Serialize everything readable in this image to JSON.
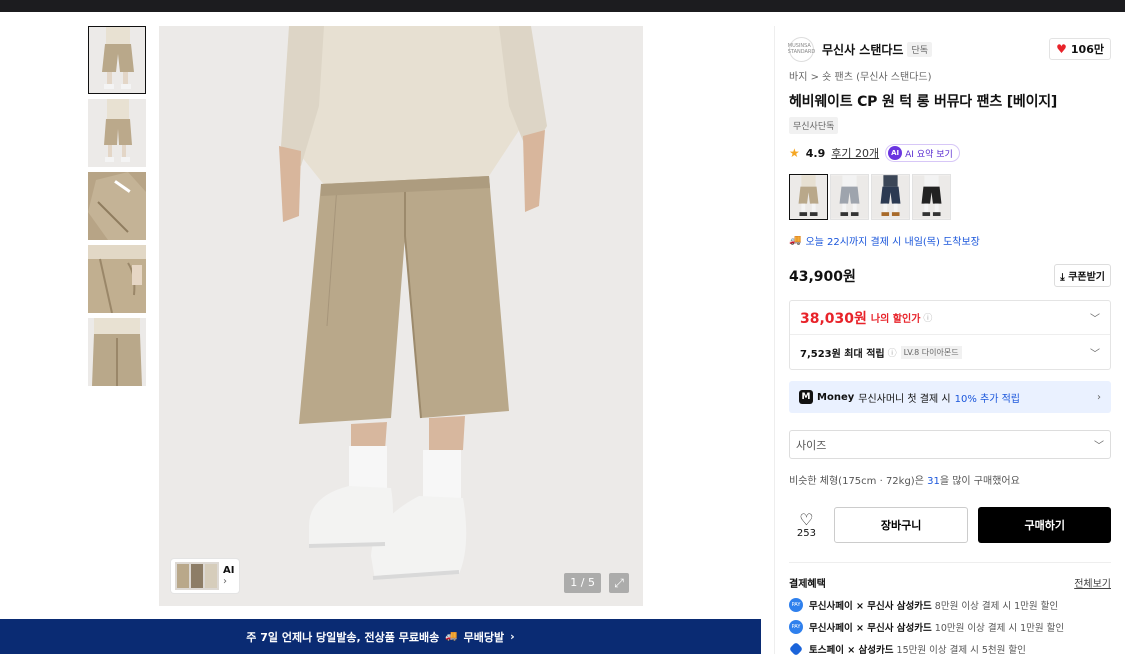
{
  "thumbnails": [
    {
      "alt": "thumbnail-1"
    },
    {
      "alt": "thumbnail-2"
    },
    {
      "alt": "thumbnail-3"
    },
    {
      "alt": "thumbnail-4"
    },
    {
      "alt": "thumbnail-5"
    }
  ],
  "gallery": {
    "ai_label": "AI",
    "ai_arrow": "›",
    "counter": "1 / 5",
    "expand_icon": "expand-icon"
  },
  "banner": {
    "text": "주 7일 언제나 당일발송, 전상품 무료배송",
    "badge": "무배당발",
    "arrow": "›"
  },
  "brand": {
    "logo_text": "MUSINSA STANDARD",
    "name": "무신사 스탠다드",
    "tag": "단독",
    "likes": "106만"
  },
  "breadcrumb": {
    "cat1": "바지",
    "sep": ">",
    "cat2": "숏 팬츠 (무신사 스탠다드)"
  },
  "product": {
    "title": "헤비웨이트 CP 원 턱 롱 버뮤다 팬츠 [베이지]",
    "exclusive_tag": "무신사단독",
    "rating": "4.9",
    "reviews": "후기 20개",
    "ai_summary": "AI 요약 보기",
    "ai_dot": "AI"
  },
  "delivery": {
    "text": "오늘 22시까지 결제 시 내일(목) 도착보장"
  },
  "price": {
    "original": "43,900원",
    "coupon_button": "쿠폰받기",
    "discounted": "38,030원",
    "discount_label": "나의 할인가",
    "points": "7,523원 최대 적립",
    "level_tag": "LV.8 다이아몬드"
  },
  "money": {
    "badge": "M",
    "brand": "Money",
    "text": "무신사머니 첫 결제 시",
    "highlight": "10% 추가 적립"
  },
  "size": {
    "placeholder": "사이즈"
  },
  "similar": {
    "prefix": "비슷한 체형(175cm · 72kg)은",
    "number": "31",
    "suffix": "을 많이 구매했어요"
  },
  "actions": {
    "wish_count": "253",
    "cart": "장바구니",
    "buy": "구매하기"
  },
  "benefits": {
    "heading": "결제혜택",
    "view_all": "전체보기",
    "items": [
      {
        "bold": "무신사페이 × 무신사 삼성카드",
        "rest": " 8만원 이상 결제 시 1만원 할인"
      },
      {
        "bold": "무신사페이 × 무신사 삼성카드",
        "rest": " 10만원 이상 결제 시 1만원 할인"
      },
      {
        "bold": "토스페이 × 삼성카드",
        "rest": " 15만원 이상 결제 시 5천원 할인"
      }
    ]
  },
  "colors": {
    "accent_red": "#e8232a",
    "accent_blue": "#1a56db",
    "banner_bg": "#0a2b73",
    "buy_bg": "#000000",
    "product_beige": "#b9a88a"
  }
}
